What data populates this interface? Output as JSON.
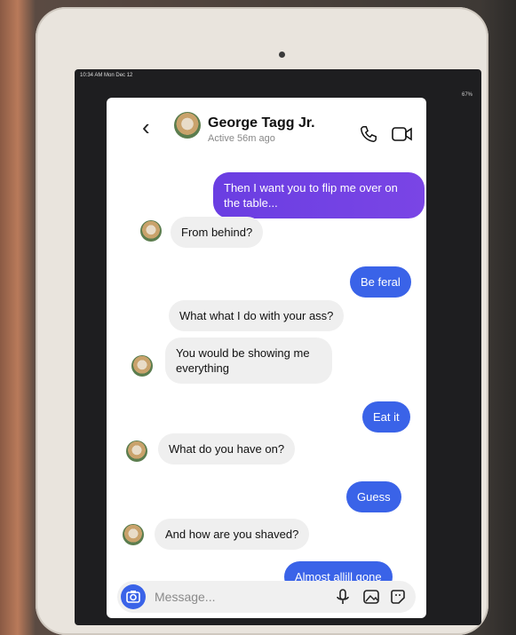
{
  "status": {
    "time": "10:34 AM  Mon Dec 12",
    "battery": "67%"
  },
  "header": {
    "back": "‹",
    "name": "George Tagg Jr.",
    "active": "Active 56m ago"
  },
  "messages": [
    {
      "side": "out",
      "text": "Then I want you to flip me over on the table..."
    },
    {
      "side": "in",
      "text": "From behind?"
    },
    {
      "side": "out",
      "text": "Be feral"
    },
    {
      "side": "in",
      "text": "What what I do with your ass?"
    },
    {
      "side": "in",
      "text": "You would be showing me everything"
    },
    {
      "side": "out",
      "text": "Eat it"
    },
    {
      "side": "in",
      "text": "What do you have on?"
    },
    {
      "side": "out",
      "text": "Guess"
    },
    {
      "side": "in",
      "text": "And how are you shaved?"
    },
    {
      "side": "out",
      "text": "Almost allill gone"
    }
  ],
  "composer": {
    "placeholder": "Message..."
  },
  "icons": [
    "back-chevron-icon",
    "phone-icon",
    "video-camera-icon",
    "camera-icon",
    "microphone-icon",
    "gallery-icon",
    "sticker-icon"
  ]
}
